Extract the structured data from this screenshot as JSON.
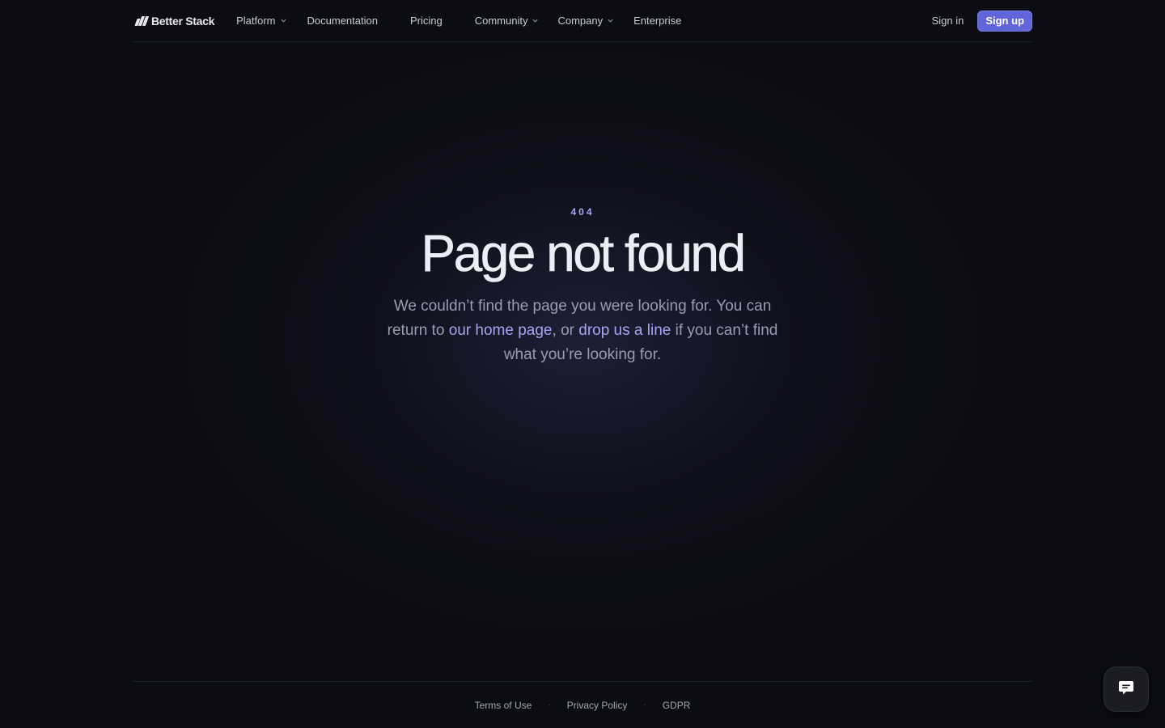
{
  "brand": {
    "name": "Better Stack"
  },
  "nav": {
    "platform": "Platform",
    "documentation": "Documentation",
    "pricing": "Pricing",
    "community": "Community",
    "company": "Company",
    "enterprise": "Enterprise"
  },
  "auth": {
    "sign_in": "Sign in",
    "sign_up": "Sign up"
  },
  "error": {
    "code": "404",
    "title": "Page not found",
    "desc_part1": "We couldn’t find the page you were looking for. You can return to ",
    "home_link": "our home page",
    "desc_part2": ", or ",
    "contact_link": "drop us a line",
    "desc_part3": " if you can’t find what you’re looking for."
  },
  "footer": {
    "terms": "Terms of Use",
    "privacy": "Privacy Policy",
    "gdpr": "GDPR",
    "separator": "·"
  },
  "colors": {
    "accent": "#6165d9",
    "link": "#a3a6f5",
    "background": "#0b0c14"
  },
  "icons": {
    "chat": "chat-bubble-icon",
    "dropdown": "chevron-down-icon"
  }
}
